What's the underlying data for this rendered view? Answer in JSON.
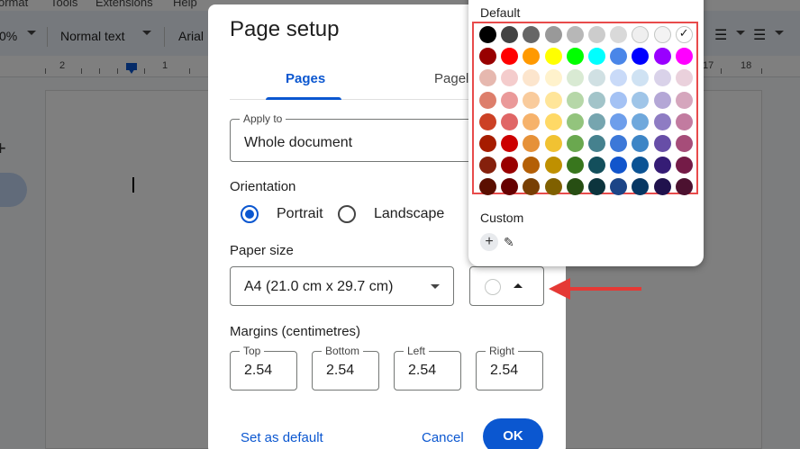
{
  "menubar": {
    "items": [
      "ormat",
      "Tools",
      "Extensions",
      "Help"
    ]
  },
  "toolbar": {
    "zoom": "0%",
    "style": "Normal text",
    "font": "Arial"
  },
  "ruler": {
    "numbers": [
      "2",
      "1",
      "17",
      "18"
    ]
  },
  "dialog": {
    "title": "Page setup",
    "tabs": [
      {
        "label": "Pages"
      },
      {
        "label": "Pagele"
      }
    ],
    "apply_to": {
      "label": "Apply to",
      "value": "Whole document"
    },
    "orientation": {
      "heading": "Orientation",
      "portrait": "Portrait",
      "landscape": "Landscape",
      "selected": "Portrait"
    },
    "paper_size": {
      "heading": "Paper size",
      "value": "A4 (21.0 cm x 29.7 cm)"
    },
    "margins": {
      "heading": "Margins (centimetres)",
      "fields": [
        {
          "label": "Top",
          "value": "2.54"
        },
        {
          "label": "Bottom",
          "value": "2.54"
        },
        {
          "label": "Left",
          "value": "2.54"
        },
        {
          "label": "Right",
          "value": "2.54"
        }
      ]
    },
    "buttons": {
      "set_default": "Set as default",
      "cancel": "Cancel",
      "ok": "OK"
    }
  },
  "palette": {
    "default_label": "Default",
    "custom_label": "Custom",
    "selected_color": "#ffffff",
    "rows": [
      [
        "#000000",
        "#434343",
        "#666666",
        "#999999",
        "#b7b7b7",
        "#cccccc",
        "#d9d9d9",
        "#efefef",
        "#f3f3f3",
        "#ffffff"
      ],
      [
        "#980000",
        "#ff0000",
        "#ff9900",
        "#ffff00",
        "#00ff00",
        "#00ffff",
        "#4a86e8",
        "#0000ff",
        "#9900ff",
        "#ff00ff"
      ],
      [
        "#e6b8af",
        "#f4cccc",
        "#fce5cd",
        "#fff2cc",
        "#d9ead3",
        "#d0e0e3",
        "#c9daf8",
        "#cfe2f3",
        "#d9d2e9",
        "#ead1dc"
      ],
      [
        "#dd7e6b",
        "#ea9999",
        "#f9cb9c",
        "#ffe599",
        "#b6d7a8",
        "#a2c4c9",
        "#a4c2f4",
        "#9fc5e8",
        "#b4a7d6",
        "#d5a6bd"
      ],
      [
        "#cc4125",
        "#e06666",
        "#f6b26b",
        "#ffd966",
        "#93c47d",
        "#76a5af",
        "#6d9eeb",
        "#6fa8dc",
        "#8e7cc3",
        "#c27ba0"
      ],
      [
        "#a61c00",
        "#cc0000",
        "#e69138",
        "#f1c232",
        "#6aa84f",
        "#45818e",
        "#3c78d8",
        "#3d85c6",
        "#674ea7",
        "#a64d79"
      ],
      [
        "#85200c",
        "#990000",
        "#b45f06",
        "#bf9000",
        "#38761d",
        "#134f5c",
        "#1155cc",
        "#0b5394",
        "#351c75",
        "#741b47"
      ],
      [
        "#5b0f00",
        "#660000",
        "#783f04",
        "#7f6000",
        "#274e13",
        "#0c343d",
        "#1c4587",
        "#073763",
        "#20124d",
        "#4c1130"
      ]
    ]
  },
  "colors": {
    "accent": "#0b57d0",
    "annotation": "#e53935"
  }
}
